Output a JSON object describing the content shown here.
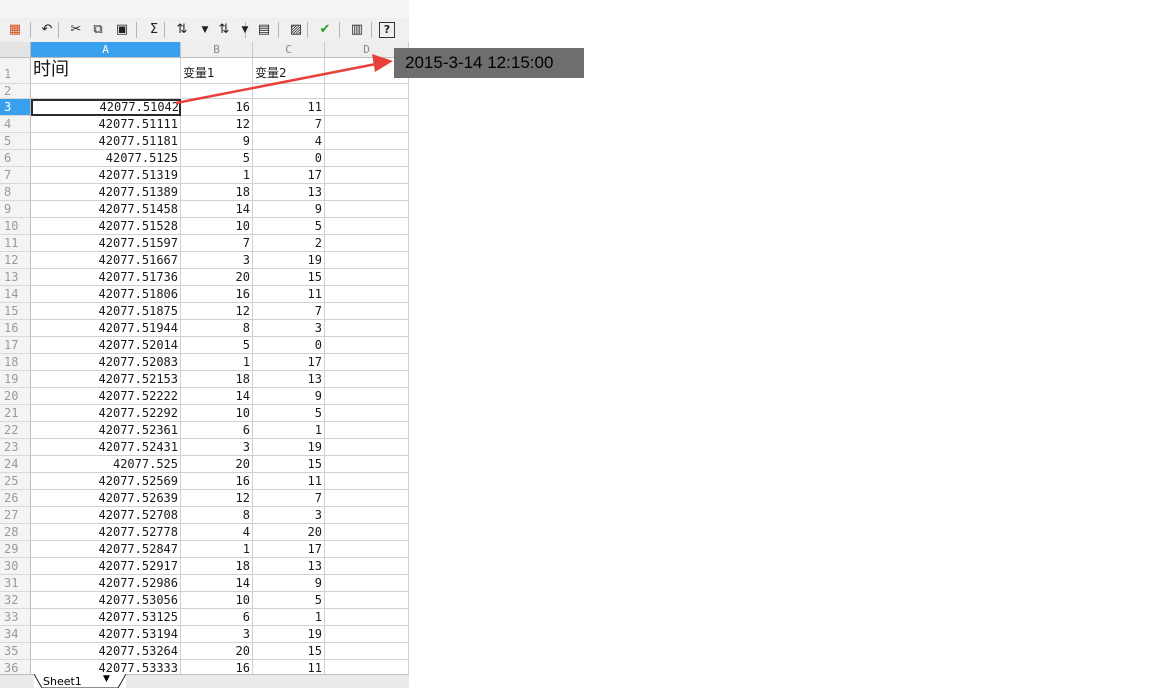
{
  "toolbar": {
    "buttons": [
      {
        "name": "format-painter-icon",
        "glyph": "▦"
      },
      {
        "name": "undo-icon",
        "glyph": "↶"
      },
      {
        "name": "cut-icon",
        "glyph": "✂"
      },
      {
        "name": "copy-icon",
        "glyph": "⧉"
      },
      {
        "name": "paste-icon",
        "glyph": "▣"
      },
      {
        "name": "sum-icon",
        "glyph": "Σ"
      },
      {
        "name": "sort-ascending-icon",
        "glyph": "⇅"
      },
      {
        "name": "sort-descending-icon",
        "glyph": "⇅"
      },
      {
        "name": "filter-icon",
        "glyph": "▤"
      },
      {
        "name": "freeze-icon",
        "glyph": "▨"
      },
      {
        "name": "spell-check-icon",
        "glyph": "✔"
      },
      {
        "name": "print-preview-icon",
        "glyph": "▥"
      },
      {
        "name": "help-icon",
        "glyph": "?"
      }
    ],
    "accent": "#39a0ee"
  },
  "columns": [
    {
      "label": "A",
      "selected": true
    },
    {
      "label": "B",
      "selected": false
    },
    {
      "label": "C",
      "selected": false
    },
    {
      "label": "D",
      "selected": false
    }
  ],
  "header_row": {
    "num": "1",
    "a": "时间",
    "b": "变量1",
    "c": "变量2"
  },
  "blank_row": {
    "num": "2"
  },
  "data_rows": [
    {
      "num": "3",
      "a": "42077.51042",
      "b": "16",
      "c": "11"
    },
    {
      "num": "4",
      "a": "42077.51111",
      "b": "12",
      "c": "7"
    },
    {
      "num": "5",
      "a": "42077.51181",
      "b": "9",
      "c": "4"
    },
    {
      "num": "6",
      "a": "42077.5125",
      "b": "5",
      "c": "0"
    },
    {
      "num": "7",
      "a": "42077.51319",
      "b": "1",
      "c": "17"
    },
    {
      "num": "8",
      "a": "42077.51389",
      "b": "18",
      "c": "13"
    },
    {
      "num": "9",
      "a": "42077.51458",
      "b": "14",
      "c": "9"
    },
    {
      "num": "10",
      "a": "42077.51528",
      "b": "10",
      "c": "5"
    },
    {
      "num": "11",
      "a": "42077.51597",
      "b": "7",
      "c": "2"
    },
    {
      "num": "12",
      "a": "42077.51667",
      "b": "3",
      "c": "19"
    },
    {
      "num": "13",
      "a": "42077.51736",
      "b": "20",
      "c": "15"
    },
    {
      "num": "14",
      "a": "42077.51806",
      "b": "16",
      "c": "11"
    },
    {
      "num": "15",
      "a": "42077.51875",
      "b": "12",
      "c": "7"
    },
    {
      "num": "16",
      "a": "42077.51944",
      "b": "8",
      "c": "3"
    },
    {
      "num": "17",
      "a": "42077.52014",
      "b": "5",
      "c": "0"
    },
    {
      "num": "18",
      "a": "42077.52083",
      "b": "1",
      "c": "17"
    },
    {
      "num": "19",
      "a": "42077.52153",
      "b": "18",
      "c": "13"
    },
    {
      "num": "20",
      "a": "42077.52222",
      "b": "14",
      "c": "9"
    },
    {
      "num": "21",
      "a": "42077.52292",
      "b": "10",
      "c": "5"
    },
    {
      "num": "22",
      "a": "42077.52361",
      "b": "6",
      "c": "1"
    },
    {
      "num": "23",
      "a": "42077.52431",
      "b": "3",
      "c": "19"
    },
    {
      "num": "24",
      "a": "42077.525",
      "b": "20",
      "c": "15"
    },
    {
      "num": "25",
      "a": "42077.52569",
      "b": "16",
      "c": "11"
    },
    {
      "num": "26",
      "a": "42077.52639",
      "b": "12",
      "c": "7"
    },
    {
      "num": "27",
      "a": "42077.52708",
      "b": "8",
      "c": "3"
    },
    {
      "num": "28",
      "a": "42077.52778",
      "b": "4",
      "c": "20"
    },
    {
      "num": "29",
      "a": "42077.52847",
      "b": "1",
      "c": "17"
    },
    {
      "num": "30",
      "a": "42077.52917",
      "b": "18",
      "c": "13"
    },
    {
      "num": "31",
      "a": "42077.52986",
      "b": "14",
      "c": "9"
    },
    {
      "num": "32",
      "a": "42077.53056",
      "b": "10",
      "c": "5"
    },
    {
      "num": "33",
      "a": "42077.53125",
      "b": "6",
      "c": "1"
    },
    {
      "num": "34",
      "a": "42077.53194",
      "b": "3",
      "c": "19"
    },
    {
      "num": "35",
      "a": "42077.53264",
      "b": "20",
      "c": "15"
    },
    {
      "num": "36",
      "a": "42077.53333",
      "b": "16",
      "c": "11"
    }
  ],
  "active_cell": {
    "row": "3",
    "col": "A"
  },
  "sheet_tab": {
    "label": "Sheet1"
  },
  "annotation": {
    "text": "2015-3-14 12:15:00",
    "arrow_color": "#e8413c"
  }
}
